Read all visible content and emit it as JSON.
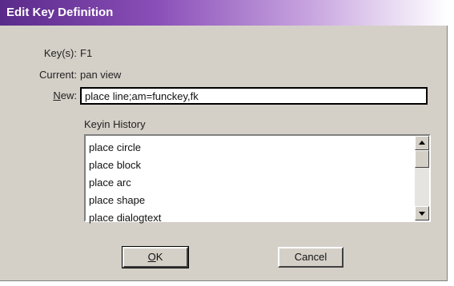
{
  "window": {
    "title": "Edit Key Definition"
  },
  "fields": {
    "keys_label": "Key(s):",
    "keys_value": "F1",
    "current_label": "Current:",
    "current_value": "pan view",
    "new_label_accel": "N",
    "new_label_rest": "ew:",
    "new_value": "place line;am=funckey,fk"
  },
  "history": {
    "label": "Keyin History",
    "items": [
      "place circle",
      "place block",
      "place arc",
      "place shape",
      "place dialogtext"
    ]
  },
  "buttons": {
    "ok_accel": "O",
    "ok_rest": "K",
    "cancel": "Cancel"
  },
  "colors": {
    "title_gradient_start": "#5a2a8a",
    "dialog_bg": "#d4d0c8"
  }
}
